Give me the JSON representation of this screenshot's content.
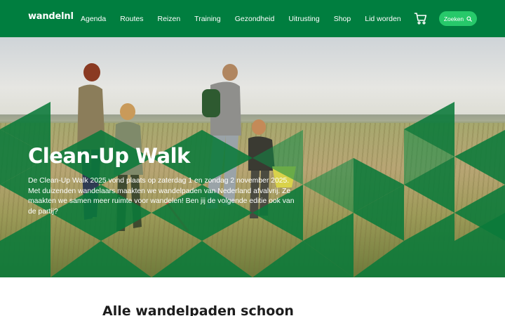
{
  "header": {
    "logo": "wandelnl",
    "nav": [
      "Agenda",
      "Routes",
      "Reizen",
      "Training",
      "Gezondheid",
      "Uitrusting",
      "Shop",
      "Lid worden"
    ],
    "search_label": "Zoeken",
    "icons": {
      "cart": "cart-icon",
      "search": "search-icon"
    }
  },
  "hero": {
    "title": "Clean-Up Walk",
    "text": "De Clean-Up Walk 2025 vond plaats op zaterdag 1 en zondag 2 november 2025. Met duizenden wandelaars maakten we wandelpaden van Nederland afvalvrij. Ze maakten we samen meer ruimte voor wandelen! Ben jij de volgende editie ook van de partij?"
  },
  "section": {
    "title": "Alle wandelpaden schoon"
  },
  "colors": {
    "brand_green": "#007e3f",
    "accent_green": "#27c96a",
    "triangle_green": "#0a7a3a"
  }
}
